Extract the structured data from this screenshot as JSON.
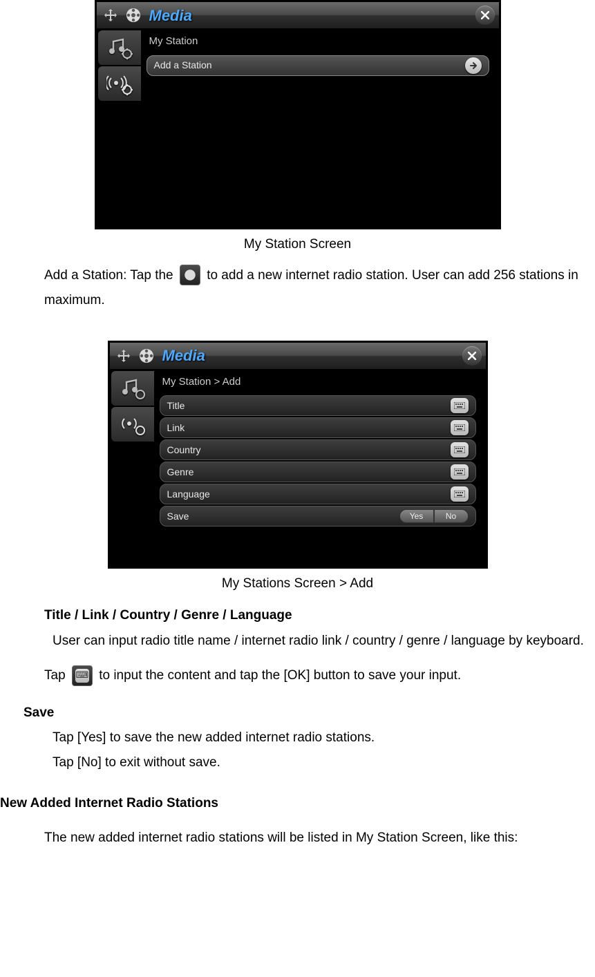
{
  "screenshot1": {
    "title": "Media",
    "breadcrumb": "My Station",
    "row_label": "Add a Station"
  },
  "caption1": "My Station Screen",
  "text_add_station_pre": "Add a Station: Tap the ",
  "text_add_station_post": " to add a new internet radio station. User can add 256 stations in maximum.",
  "screenshot2": {
    "title": "Media",
    "breadcrumb": "My Station > Add",
    "rows": [
      {
        "label": "Title"
      },
      {
        "label": "Link"
      },
      {
        "label": "Country"
      },
      {
        "label": "Genre"
      },
      {
        "label": "Language"
      }
    ],
    "save_label": "Save",
    "yes": "Yes",
    "no": "No"
  },
  "caption2": "My Stations Screen > Add",
  "heading_fields": "Title / Link / Country / Genre / Language",
  "text_fields_desc": "User can input radio title name / internet radio link / country / genre / language by keyboard.",
  "text_tap_pre": "Tap ",
  "text_tap_post": " to input the content and tap the [OK] button to save your input.",
  "heading_save": "Save",
  "text_save_yes": "Tap [Yes] to save the new added internet radio stations.",
  "text_save_no": "Tap [No] to exit without save.",
  "heading_new": "New Added Internet Radio Stations",
  "text_new": "The new added internet radio stations will be listed in My Station Screen, like this:"
}
